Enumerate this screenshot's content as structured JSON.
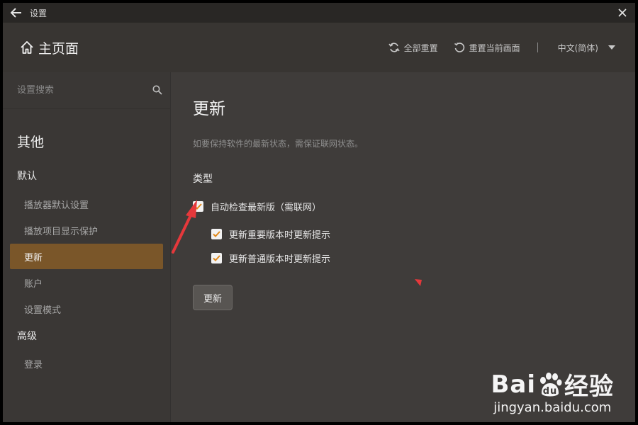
{
  "titlebar": {
    "title": "设置"
  },
  "header": {
    "home_label": "主页面",
    "reset_all": "全部重置",
    "reset_current": "重置当前画面",
    "language": "中文(简体)"
  },
  "sidebar": {
    "search_placeholder": "设置搜索",
    "category": "其他",
    "groups": [
      {
        "label": "默认",
        "items": [
          "播放器默认设置",
          "播放项目显示保护",
          "更新",
          "账户",
          "设置模式"
        ]
      },
      {
        "label": "高级",
        "items": [
          "登录"
        ]
      }
    ],
    "active_item": "更新"
  },
  "main": {
    "title": "更新",
    "description": "如要保持软件的最新状态，需保证联网状态。",
    "section_label": "类型",
    "checkboxes": [
      {
        "label": "自动检查最新版（需联网）",
        "checked": true
      },
      {
        "label": "更新重要版本时更新提示",
        "checked": true
      },
      {
        "label": "更新普通版本时更新提示",
        "checked": true
      }
    ],
    "update_button": "更新"
  },
  "watermark": {
    "text": "Bai du 经验",
    "url": "jingyan.baidu.com"
  },
  "colors": {
    "accent": "#7a5629",
    "check": "#e08a1e",
    "annotation": "#e5383b"
  }
}
